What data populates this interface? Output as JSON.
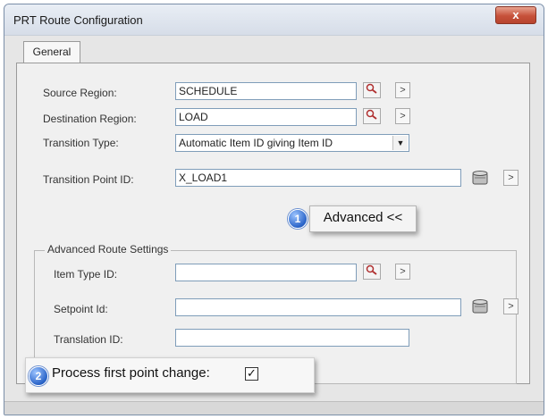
{
  "window": {
    "title": "PRT Route Configuration",
    "close_glyph": "x"
  },
  "tabs": [
    {
      "label": "General"
    }
  ],
  "fields": {
    "source_region": {
      "label": "Source Region:",
      "value": "SCHEDULE"
    },
    "destination_region": {
      "label": "Destination Region:",
      "value": "LOAD"
    },
    "transition_type": {
      "label": "Transition Type:",
      "value": "Automatic Item ID giving Item ID"
    },
    "transition_point_id": {
      "label": "Transition Point ID:",
      "value": "X_LOAD1"
    }
  },
  "advanced": {
    "callout_number": "1",
    "button_label": "Advanced <<",
    "group_label": "Advanced Route Settings",
    "item_type_id": {
      "label": "Item Type ID:",
      "value": ""
    },
    "setpoint_id": {
      "label": "Setpoint Id:",
      "value": ""
    },
    "translation_id": {
      "label": "Translation ID:",
      "value": ""
    },
    "process_first_point": {
      "callout_number": "2",
      "label": "Process first point change:",
      "checked": true,
      "check_glyph": "✓"
    }
  },
  "icons": {
    "lookup": "search-icon",
    "navigate": "arrow-right-icon",
    "browse": "database-icon",
    "dropdown": "chevron-down-icon"
  },
  "glyphs": {
    "nav": ">",
    "dropdown": "▼"
  }
}
